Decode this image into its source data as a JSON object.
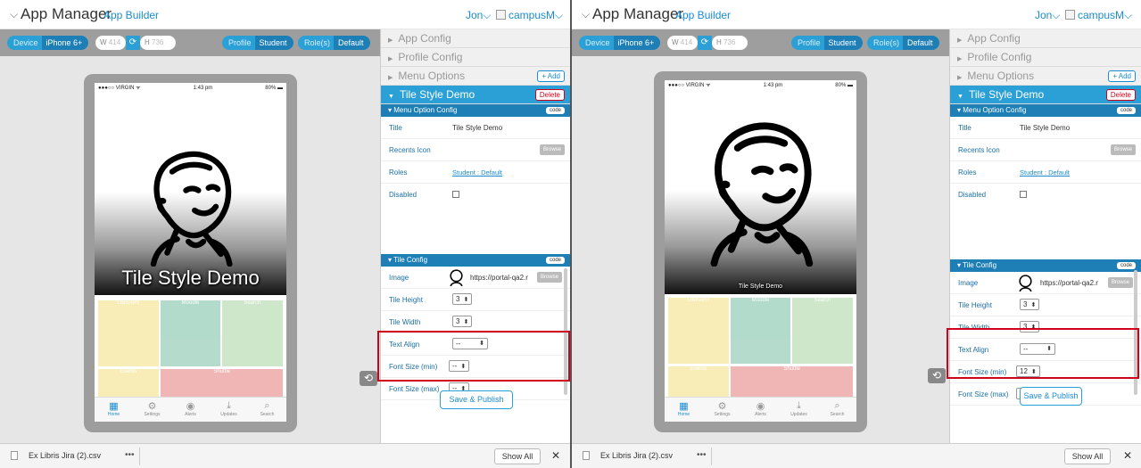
{
  "app": {
    "chevron": "⌵",
    "title": "App Manager",
    "subtitle": "App Builder",
    "user": "Jon",
    "campus": "campusM",
    "caret": "⌵"
  },
  "toolbar": {
    "device_label": "Device",
    "device_value": "iPhone 6+",
    "width_label": "W",
    "width_value": "414",
    "refresh_icon": "refresh-icon",
    "height_label": "H",
    "height_value": "736",
    "profile_label": "Profile",
    "profile_value": "Student",
    "roles_label": "Role(s)",
    "roles_value": "Default"
  },
  "phone": {
    "carrier": "●●●○○ VIRGIN ᯤ",
    "time": "1:43 pm",
    "battery": "80% ▬",
    "tiles": [
      "LIBRARY",
      "Moodle",
      "Search",
      "Events",
      "Shuttle"
    ],
    "dock": [
      {
        "icon": "▦",
        "label": "Home"
      },
      {
        "icon": "⚙",
        "label": "Settings"
      },
      {
        "icon": "◉",
        "label": "Alerts"
      },
      {
        "icon": "⤓",
        "label": "Updates"
      },
      {
        "icon": "⌕",
        "label": "Search"
      }
    ]
  },
  "panel": {
    "app_config": "App Config",
    "profile_config": "Profile Config",
    "menu_options": "Menu Options",
    "add_label": "+ Add",
    "tile_style": "Tile Style Demo",
    "delete_label": "Delete",
    "menu_option_config": "Menu Option Config",
    "code_label": "code",
    "title_label": "Title",
    "title_value": "Tile Style Demo",
    "recents_icon_label": "Recents Icon",
    "browse_label": "Browse",
    "roles_label": "Roles",
    "roles_value": "Student : Default",
    "disabled_label": "Disabled",
    "tile_config": "Tile Config",
    "image_label": "Image",
    "image_url": "https://portal-qa2.r",
    "tile_height_label": "Tile Height",
    "tile_width_label": "Tile Width",
    "text_align_label": "Text Align",
    "font_min_label": "Font Size (min)",
    "font_max_label": "Font Size (max)",
    "save_publish": "Save & Publish"
  },
  "left": {
    "tile_height": "3",
    "tile_width": "3",
    "text_align": "--",
    "font_min": "--",
    "font_max": "--",
    "tile_caption": "Tile Style Demo"
  },
  "right": {
    "tile_height": "3",
    "tile_width": "3",
    "text_align": "--",
    "font_min": "12",
    "font_max": "12",
    "tile_caption": "Tile Style Demo"
  },
  "footer": {
    "filename": "Ex Libris Jira (2).csv",
    "more": "•••",
    "show_all": "Show All",
    "close": "✕"
  },
  "colors": {
    "accent": "#2aa0d6",
    "highlight": "#d0021b",
    "tiles": [
      "#f0d860",
      "#58b08e",
      "#93c98a",
      "#f0d860",
      "#e0605f"
    ]
  }
}
